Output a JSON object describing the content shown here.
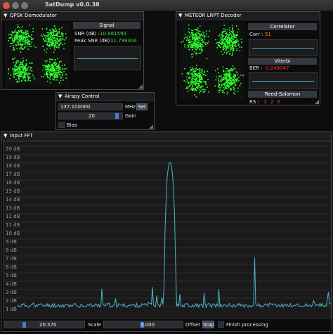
{
  "app": {
    "title": "SatDump v0.0.38"
  },
  "qpsk": {
    "title": "QPSK Demodulator",
    "signal_header": "Signal",
    "snr_label": "SNR (dB) :",
    "snr_value": "10.981590",
    "peak_label": "Peak SNR (dB) :",
    "peak_value": "11.799304"
  },
  "meteor": {
    "title": "METEOR LRPT Decoder",
    "correlator_header": "Correlator",
    "corr_label": "Corr :",
    "corr_value": "51",
    "viterbi_header": "Viterbi",
    "ber_label": "BER :",
    "ber_value": "0.248047",
    "rs_header": "Reed-Solomon",
    "rs_label": "RS :",
    "rs_markers": [
      "1",
      "2",
      "3"
    ]
  },
  "airspy": {
    "title": "Airspy Control",
    "frequency": "137.100000",
    "freq_unit": "MHz",
    "set_label": "Set",
    "gain_value": "20",
    "gain_label": "Gain",
    "bias_label": "Bias"
  },
  "fft": {
    "title": "Input FFT",
    "y_labels": [
      "20 dB",
      "19 dB",
      "18 dB",
      "17 dB",
      "16 dB",
      "15 dB",
      "14 dB",
      "13 dB",
      "12 dB",
      "11 dB",
      "10 dB",
      "9 dB",
      "8 dB",
      "7 dB",
      "6 dB",
      "5 dB",
      "4 dB",
      "3 dB",
      "2 dB",
      "1 dB"
    ],
    "slider_value": "20.570",
    "scale_label": "Scale",
    "offset_value": "0.000",
    "offset_label": "Offset",
    "stop_label": "Stop",
    "finish_label": "Finish processing"
  },
  "colors": {
    "trace": "#4fb3c8",
    "constellation": "#2fff2f",
    "accent": "#3f7fd6"
  }
}
